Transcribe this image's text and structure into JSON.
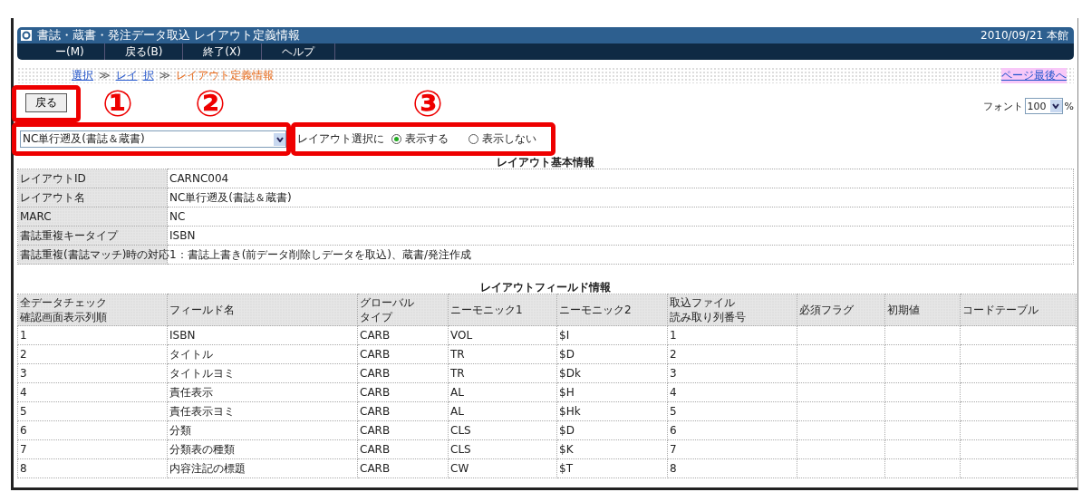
{
  "header": {
    "title": "書誌・蔵書・発注データ取込 レイアウト定義情報",
    "date": "2010/09/21 本館"
  },
  "menu": [
    {
      "label": "ー(M)"
    },
    {
      "label": "戻る(B)"
    },
    {
      "label": "終了(X)"
    },
    {
      "label": "ヘルプ"
    }
  ],
  "breadcrumbs": [
    {
      "parts": [
        "選択"
      ],
      "kind": "link"
    },
    {
      "parts": [
        "レイ",
        "択"
      ],
      "kind": "link"
    },
    {
      "parts": [
        "レイアウト定義情報"
      ],
      "kind": "current"
    }
  ],
  "separator": "≫",
  "page_end_link": "ページ最後へ",
  "font": {
    "label": "フォント",
    "value": "100",
    "unit": "%"
  },
  "back_button": "戻る",
  "layout_select": {
    "value": "NC単行遡及(書誌＆蔵書)"
  },
  "display_option": {
    "label": "レイアウト選択に",
    "options": [
      {
        "label": "表示する",
        "selected": true
      },
      {
        "label": "表示しない",
        "selected": false
      }
    ]
  },
  "annotations": [
    {
      "label": "①"
    },
    {
      "label": "②"
    },
    {
      "label": "③"
    }
  ],
  "basic_info": {
    "title": "レイアウト基本情報",
    "rows": [
      {
        "label": "レイアウトID",
        "value": "CARNC004"
      },
      {
        "label": "レイアウト名",
        "value": "NC単行遡及(書誌＆蔵書)"
      },
      {
        "label": "MARC",
        "value": "NC"
      },
      {
        "label": "書誌重複キータイプ",
        "value": "ISBN"
      },
      {
        "label": "書誌重複(書誌マッチ)時の対応",
        "value": "1：書誌上書き(前データ削除しデータを取込)、蔵書/発注作成"
      }
    ]
  },
  "field_info": {
    "title": "レイアウトフィールド情報",
    "columns": [
      {
        "line1": "全データチェック",
        "line2": "確認画面表示列順"
      },
      {
        "line1": "フィールド名"
      },
      {
        "line1": "グローバル",
        "line2": "タイプ"
      },
      {
        "line1": "ニーモニック1"
      },
      {
        "line1": "ニーモニック2"
      },
      {
        "line1": "取込ファイル",
        "line2": "読み取り列番号"
      },
      {
        "line1": "必須フラグ"
      },
      {
        "line1": "初期値"
      },
      {
        "line1": "コードテーブル"
      }
    ],
    "rows": [
      [
        "1",
        "ISBN",
        "CARB",
        "VOL",
        "$I",
        "1",
        "",
        "",
        ""
      ],
      [
        "2",
        "タイトル",
        "CARB",
        "TR",
        "$D",
        "2",
        "",
        "",
        ""
      ],
      [
        "3",
        "タイトルヨミ",
        "CARB",
        "TR",
        "$Dk",
        "3",
        "",
        "",
        ""
      ],
      [
        "4",
        "責任表示",
        "CARB",
        "AL",
        "$H",
        "4",
        "",
        "",
        ""
      ],
      [
        "5",
        "責任表示ヨミ",
        "CARB",
        "AL",
        "$Hk",
        "5",
        "",
        "",
        ""
      ],
      [
        "6",
        "分類",
        "CARB",
        "CLS",
        "$D",
        "6",
        "",
        "",
        ""
      ],
      [
        "7",
        "分類表の種類",
        "CARB",
        "CLS",
        "$K",
        "7",
        "",
        "",
        ""
      ],
      [
        "8",
        "内容注記の標題",
        "CARB",
        "CW",
        "$T",
        "8",
        "",
        "",
        ""
      ]
    ]
  }
}
